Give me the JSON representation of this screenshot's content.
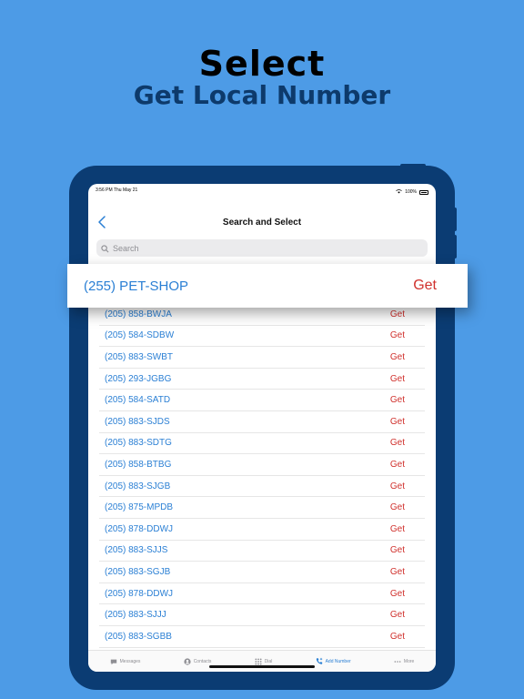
{
  "promo": {
    "headline": "Select",
    "subheadline": "Get Local Number"
  },
  "statusbar": {
    "time": "3:56 PM",
    "date": "Thu May 21",
    "battery": "100%"
  },
  "navbar": {
    "title": "Search and Select"
  },
  "search": {
    "placeholder": "Search"
  },
  "highlight": {
    "number": "(255) PET-SHOP",
    "action": "Get"
  },
  "numbers": [
    {
      "number": "(205) 858-BWJA",
      "action": "Get"
    },
    {
      "number": "(205) 584-SDBW",
      "action": "Get"
    },
    {
      "number": "(205) 883-SWBT",
      "action": "Get"
    },
    {
      "number": "(205) 293-JGBG",
      "action": "Get"
    },
    {
      "number": "(205) 584-SATD",
      "action": "Get"
    },
    {
      "number": "(205) 883-SJDS",
      "action": "Get"
    },
    {
      "number": "(205) 883-SDTG",
      "action": "Get"
    },
    {
      "number": "(205) 858-BTBG",
      "action": "Get"
    },
    {
      "number": "(205) 883-SJGB",
      "action": "Get"
    },
    {
      "number": "(205) 875-MPDB",
      "action": "Get"
    },
    {
      "number": "(205) 878-DDWJ",
      "action": "Get"
    },
    {
      "number": "(205) 883-SJJS",
      "action": "Get"
    },
    {
      "number": "(205) 883-SGJB",
      "action": "Get"
    },
    {
      "number": "(205) 878-DDWJ",
      "action": "Get"
    },
    {
      "number": "(205) 883-SJJJ",
      "action": "Get"
    },
    {
      "number": "(205) 883-SGBB",
      "action": "Get"
    }
  ],
  "tabbar": {
    "items": [
      {
        "label": "Messages",
        "icon": "chat-icon"
      },
      {
        "label": "Contacts",
        "icon": "person-icon"
      },
      {
        "label": "Dial",
        "icon": "keypad-icon"
      },
      {
        "label": "Add Number",
        "icon": "phone-plus-icon"
      },
      {
        "label": "More",
        "icon": "ellipsis-icon"
      }
    ]
  },
  "colors": {
    "background": "#4d9be6",
    "tablet": "#0b3c73",
    "number": "#2a7fd4",
    "get": "#d0312d"
  }
}
